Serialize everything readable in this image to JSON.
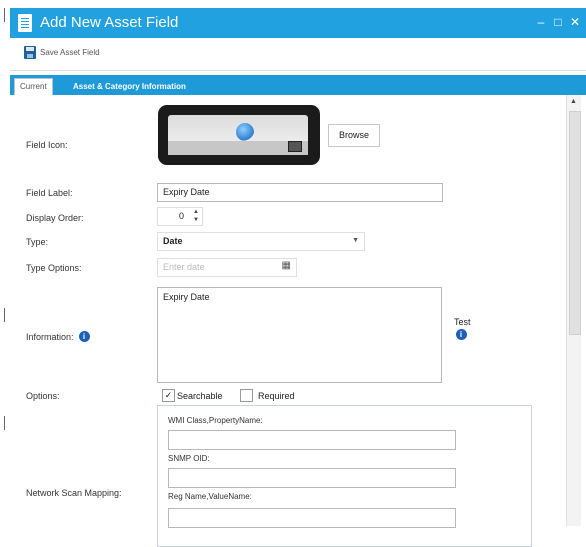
{
  "window": {
    "title": "Add New Asset Field",
    "controls": [
      "–",
      "□",
      "✕"
    ]
  },
  "toolbar": {
    "save_label": "Save Asset Field"
  },
  "tabs": [
    {
      "label": "Current"
    },
    {
      "label": "Asset & Category Information"
    }
  ],
  "form": {
    "field_icon_label": "Field Icon:",
    "browse_label": "Browse",
    "field_label_label": "Field Label:",
    "field_label_value": "Expiry Date",
    "display_order_label": "Display Order:",
    "display_order_value": "0",
    "type_label": "Type:",
    "type_value": "Date",
    "type_options_label": "Type Options:",
    "type_options_placeholder": "Enter date",
    "information_label": "Information:",
    "information_value": "Expiry Date",
    "test_label": "Test",
    "options_label": "Options:",
    "searchable_label": "Searchable",
    "searchable_checked": true,
    "required_label": "Required",
    "required_checked": false,
    "network_scan_label": "Network Scan Mapping:",
    "wmi_label": "WMI Class,PropertyName:",
    "snmp_label": "SNMP OID:",
    "reg_label": "Reg Name,ValueName:"
  },
  "icons": {
    "window": "document-icon",
    "save": "floppy-disk-icon",
    "info": "info-icon",
    "calendar": "calendar-icon"
  },
  "colors": {
    "accent": "#22a1e0",
    "tabbar": "#1f9ad9",
    "info": "#1f5fb8"
  }
}
